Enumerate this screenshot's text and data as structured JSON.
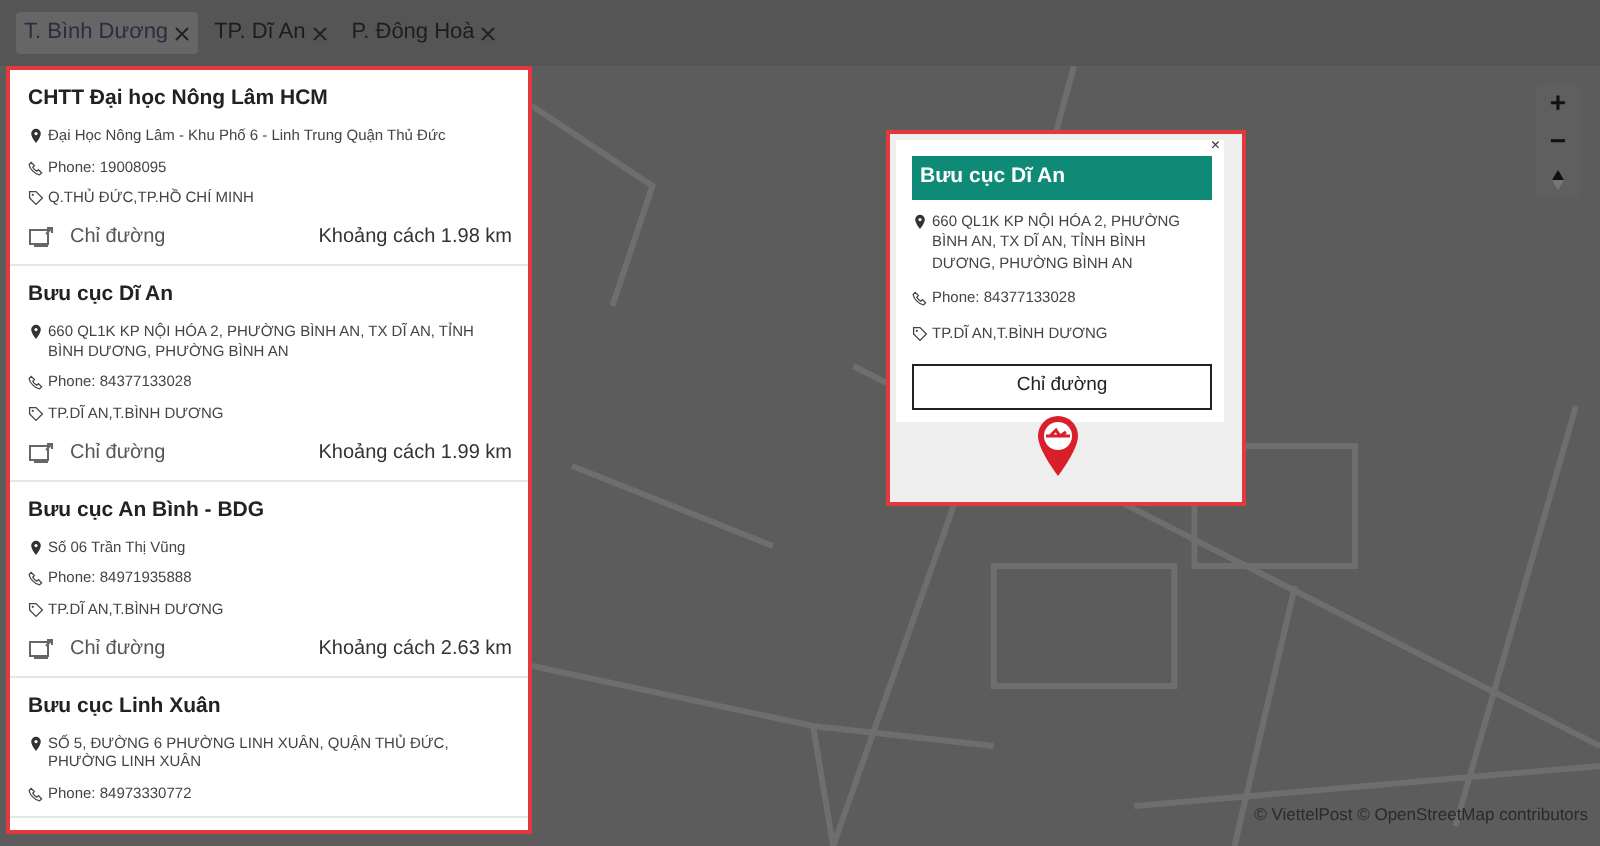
{
  "filters": [
    {
      "label": "T. Bình Dương",
      "selected": true
    },
    {
      "label": "TP. Dĩ An",
      "selected": false
    },
    {
      "label": "P. Đông Hoà",
      "selected": false
    }
  ],
  "places": [
    {
      "name": "CHTT Đại học Nông Lâm HCM",
      "address": "Đại Học Nông Lâm - Khu Phố 6 - Linh Trung Quận Thủ Đức",
      "phone": "Phone: 19008095",
      "area": "Q.THỦ ĐỨC,TP.HỒ CHÍ MINH",
      "directions": "Chỉ đường",
      "distance": "Khoảng cách 1.98 km"
    },
    {
      "name": "Bưu cục Dĩ An",
      "address": "660 QL1K KP NỘI HÓA 2, PHƯỜNG BÌNH AN, TX DĨ AN, TỈNH BÌNH DƯƠNG, PHƯỜNG BÌNH AN",
      "phone": "Phone: 84377133028",
      "area": "TP.DĨ AN,T.BÌNH DƯƠNG",
      "directions": "Chỉ đường",
      "distance": "Khoảng cách 1.99 km"
    },
    {
      "name": "Bưu cục An Bình - BDG",
      "address": "Số 06 Trần Thị Vũng",
      "phone": "Phone: 84971935888",
      "area": "TP.DĨ AN,T.BÌNH DƯƠNG",
      "directions": "Chỉ đường",
      "distance": "Khoảng cách 2.63 km"
    },
    {
      "name": "Bưu cục Linh Xuân",
      "address": "SỐ 5, ĐƯỜNG 6 PHƯỜNG LINH XUÂN, QUẬN THỦ ĐỨC, PHƯỜNG LINH XUÂN",
      "phone": "Phone: 84973330772"
    }
  ],
  "popup": {
    "close": "×",
    "name": "Bưu cục Dĩ An",
    "address": "660 QL1K KP NỘI HÓA 2, PHƯỜNG BÌNH AN, TX DĨ AN, TỈNH BÌNH DƯƠNG, PHƯỜNG BÌNH AN",
    "phone": "Phone: 84377133028",
    "area": "TP.DĨ AN,T.BÌNH DƯƠNG",
    "button": "Chỉ đường"
  },
  "map_controls": {
    "zoom_in": "+",
    "zoom_out": "−"
  },
  "attribution": "© ViettelPost © OpenStreetMap contributors"
}
